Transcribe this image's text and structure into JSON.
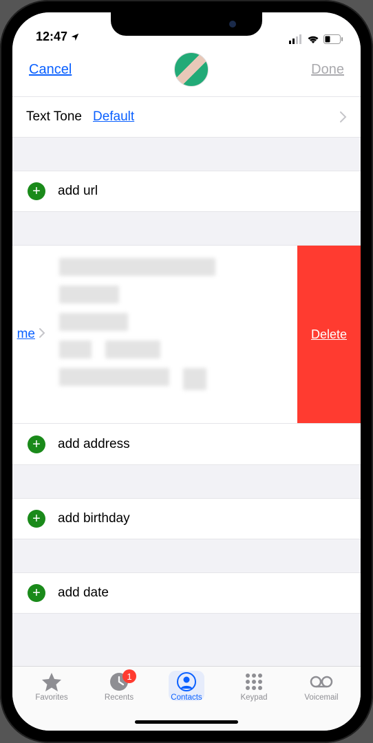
{
  "status": {
    "time": "12:47"
  },
  "nav": {
    "cancel": "Cancel",
    "done": "Done"
  },
  "textTone": {
    "label": "Text Tone",
    "value": "Default"
  },
  "addUrl": "add url",
  "address": {
    "typeFragment": "me",
    "deleteLabel": "Delete"
  },
  "addAddress": "add address",
  "addBirthday": "add birthday",
  "addDate": "add date",
  "tabs": {
    "favorites": "Favorites",
    "recents": "Recents",
    "recentsBadge": "1",
    "contacts": "Contacts",
    "keypad": "Keypad",
    "voicemail": "Voicemail"
  }
}
